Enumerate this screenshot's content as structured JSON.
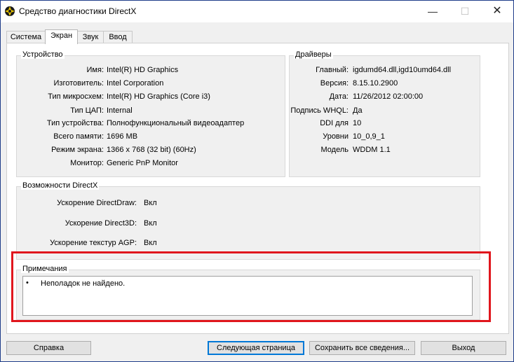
{
  "window": {
    "title": "Средство диагностики DirectX",
    "min_glyph": "—",
    "max_glyph": "☐",
    "close_glyph": "✕"
  },
  "tabs": [
    {
      "label": "Система",
      "active": false
    },
    {
      "label": "Экран",
      "active": true
    },
    {
      "label": "Звук",
      "active": false
    },
    {
      "label": "Ввод",
      "active": false
    }
  ],
  "device": {
    "title": "Устройство",
    "rows": [
      {
        "label": "Имя:",
        "value": "Intel(R) HD Graphics"
      },
      {
        "label": "Изготовитель:",
        "value": "Intel Corporation"
      },
      {
        "label": "Тип микросхем:",
        "value": "Intel(R) HD Graphics (Core i3)"
      },
      {
        "label": "Тип ЦАП:",
        "value": "Internal"
      },
      {
        "label": "Тип устройства:",
        "value": "Полнофункциональный видеоадаптер"
      },
      {
        "label": "Всего памяти:",
        "value": "1696 MB"
      },
      {
        "label": "Режим экрана:",
        "value": "1366 x 768 (32 bit) (60Hz)"
      },
      {
        "label": "Монитор:",
        "value": "Generic PnP Monitor"
      }
    ]
  },
  "drivers": {
    "title": "Драйверы",
    "rows": [
      {
        "label": "Главный:",
        "value": "igdumd64.dll,igd10umd64.dll"
      },
      {
        "label": "Версия:",
        "value": "8.15.10.2900"
      },
      {
        "label": "Дата:",
        "value": "11/26/2012 02:00:00"
      },
      {
        "label": "Подпись WHQL:",
        "value": "Да"
      },
      {
        "label": "DDI для",
        "value": "10"
      },
      {
        "label": "Уровни",
        "value": "10_0,9_1"
      },
      {
        "label": "Модель",
        "value": "WDDM 1.1"
      }
    ]
  },
  "directx": {
    "title": "Возможности DirectX",
    "rows": [
      {
        "label": "Ускорение DirectDraw:",
        "value": "Вкл"
      },
      {
        "label": "Ускорение Direct3D:",
        "value": "Вкл"
      },
      {
        "label": "Ускорение текстур AGP:",
        "value": "Вкл"
      }
    ]
  },
  "notes": {
    "title": "Примечания",
    "bullet": "•",
    "text": "Неполадок не найдено."
  },
  "buttons": {
    "help": "Справка",
    "next": "Следующая страница",
    "save": "Сохранить все сведения...",
    "exit": "Выход"
  },
  "colors": {
    "highlight": "#e0161d",
    "default_button_border": "#0078d7"
  }
}
